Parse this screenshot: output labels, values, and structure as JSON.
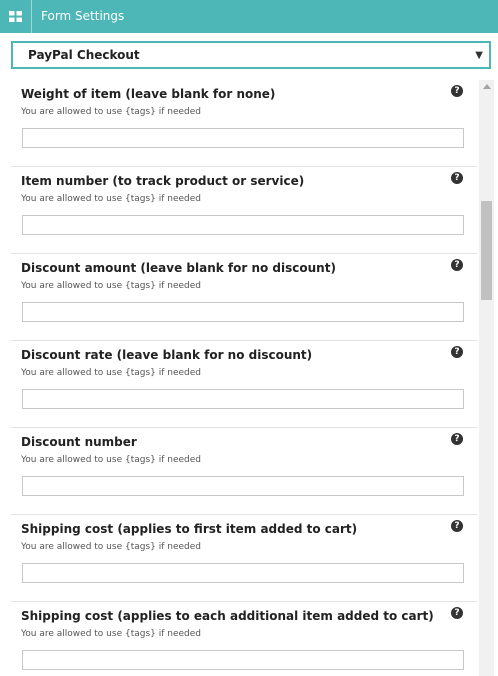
{
  "header": {
    "title": "Form Settings",
    "menu_icon": "grid-icon"
  },
  "select": {
    "value": "PayPal Checkout",
    "caret": "▼"
  },
  "help_glyph": "?",
  "fields": [
    {
      "label": "Weight of item (leave blank for none)",
      "hint": "You are allowed to use {tags} if needed",
      "value": ""
    },
    {
      "label": "Item number (to track product or service)",
      "hint": "You are allowed to use {tags} if needed",
      "value": ""
    },
    {
      "label": "Discount amount (leave blank for no discount)",
      "hint": "You are allowed to use {tags} if needed",
      "value": ""
    },
    {
      "label": "Discount rate (leave blank for no discount)",
      "hint": "You are allowed to use {tags} if needed",
      "value": ""
    },
    {
      "label": "Discount number",
      "hint": "You are allowed to use {tags} if needed",
      "value": ""
    },
    {
      "label": "Shipping cost (applies to first item added to cart)",
      "hint": "You are allowed to use {tags} if needed",
      "value": ""
    },
    {
      "label": "Shipping cost (applies to each additional item added to cart)",
      "hint": "You are allowed to use {tags} if needed",
      "value": ""
    }
  ],
  "colors": {
    "accent": "#4db6b6",
    "help_icon": "#333333"
  }
}
